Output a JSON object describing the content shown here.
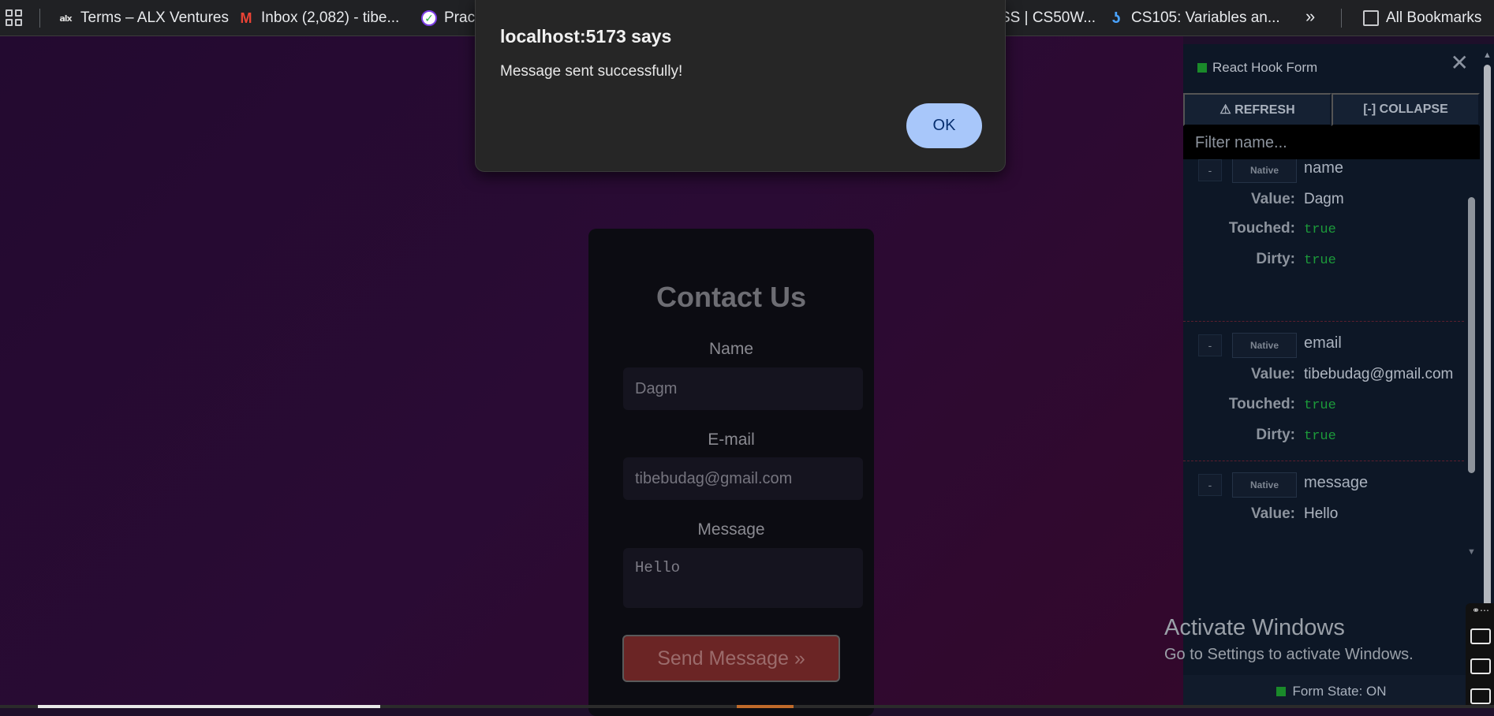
{
  "bookmarks": {
    "items": [
      {
        "label": "Terms – ALX Ventures",
        "icon": "alx-icon"
      },
      {
        "label": "Inbox (2,082) - tibe...",
        "icon": "gmail-icon"
      },
      {
        "label": "Pract",
        "icon": "checkmark-icon"
      },
      {
        "label": "SS | CS50W...",
        "icon": ""
      },
      {
        "label": "CS105: Variables an...",
        "icon": "cs-icon"
      }
    ],
    "overflow": "»",
    "all_bookmarks": "All Bookmarks"
  },
  "form": {
    "title": "Contact Us",
    "name_label": "Name",
    "name_value": "Dagm",
    "email_label": "E-mail",
    "email_value": "tibebudag@gmail.com",
    "message_label": "Message",
    "message_value": "Hello",
    "submit_label": "Send Message »"
  },
  "dialog": {
    "title": "localhost:5173 says",
    "message": "Message sent successfully!",
    "ok_label": "OK"
  },
  "devtools": {
    "title": "React Hook Form",
    "refresh_label": "⚠ REFRESH",
    "collapse_label": "[-] COLLAPSE",
    "filter_placeholder": "Filter name...",
    "minus": "-",
    "native": "Native",
    "value_key": "Value:",
    "touched_key": "Touched:",
    "dirty_key": "Dirty:",
    "fields": [
      {
        "name": "name",
        "value": "Dagm",
        "touched": "true",
        "dirty": "true"
      },
      {
        "name": "email",
        "value": "tibebudag@gmail.com",
        "touched": "true",
        "dirty": "true"
      },
      {
        "name": "message",
        "value": "Hello",
        "touched": "true"
      }
    ],
    "footer": "Form State: ON"
  },
  "watermark": {
    "title": "Activate Windows",
    "subtitle": "Go to Settings to activate Windows."
  },
  "colors": {
    "dialog_button": "#a8c7fa",
    "submit_button": "#6b2525",
    "devtools_bg": "#0d1726",
    "true_green": "#1c9a3a"
  }
}
